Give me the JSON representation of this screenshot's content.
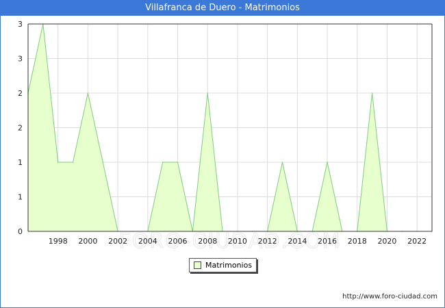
{
  "header": {
    "title": "Villafranca de Duero - Matrimonios"
  },
  "chart_data": {
    "type": "area",
    "title": "Villafranca de Duero - Matrimonios",
    "xlabel": "",
    "ylabel": "",
    "x": [
      1996,
      1997,
      1998,
      1999,
      2000,
      2001,
      2002,
      2003,
      2004,
      2005,
      2006,
      2007,
      2008,
      2009,
      2010,
      2011,
      2012,
      2013,
      2014,
      2015,
      2016,
      2017,
      2018,
      2019,
      2020,
      2021,
      2022,
      2023
    ],
    "series": [
      {
        "name": "Matrimonios",
        "values": [
          2,
          3,
          1,
          1,
          2,
          1,
          0,
          0,
          0,
          1,
          1,
          0,
          2,
          0,
          0,
          0,
          0,
          1,
          0,
          0,
          1,
          0,
          0,
          2,
          0,
          0,
          0,
          0
        ]
      }
    ],
    "xlim": [
      1996,
      2023
    ],
    "ylim": [
      0,
      3
    ],
    "x_ticks": [
      "1998",
      "2000",
      "2002",
      "2004",
      "2006",
      "2008",
      "2010",
      "2012",
      "2014",
      "2016",
      "2018",
      "2020",
      "2022"
    ],
    "y_ticks": [
      "0",
      "1",
      "1",
      "2",
      "2",
      "3",
      "3"
    ],
    "grid": true,
    "legend_position": "bottom-center",
    "colors": {
      "fill": "#e6ffcc",
      "line": "#80cc80",
      "grid": "#dddddd",
      "header": "#3c78d8"
    }
  },
  "legend": {
    "label": "Matrimonios"
  },
  "watermark": "FORO-CIUDAD.COM",
  "footer": {
    "source": "http://www.foro-ciudad.com"
  }
}
